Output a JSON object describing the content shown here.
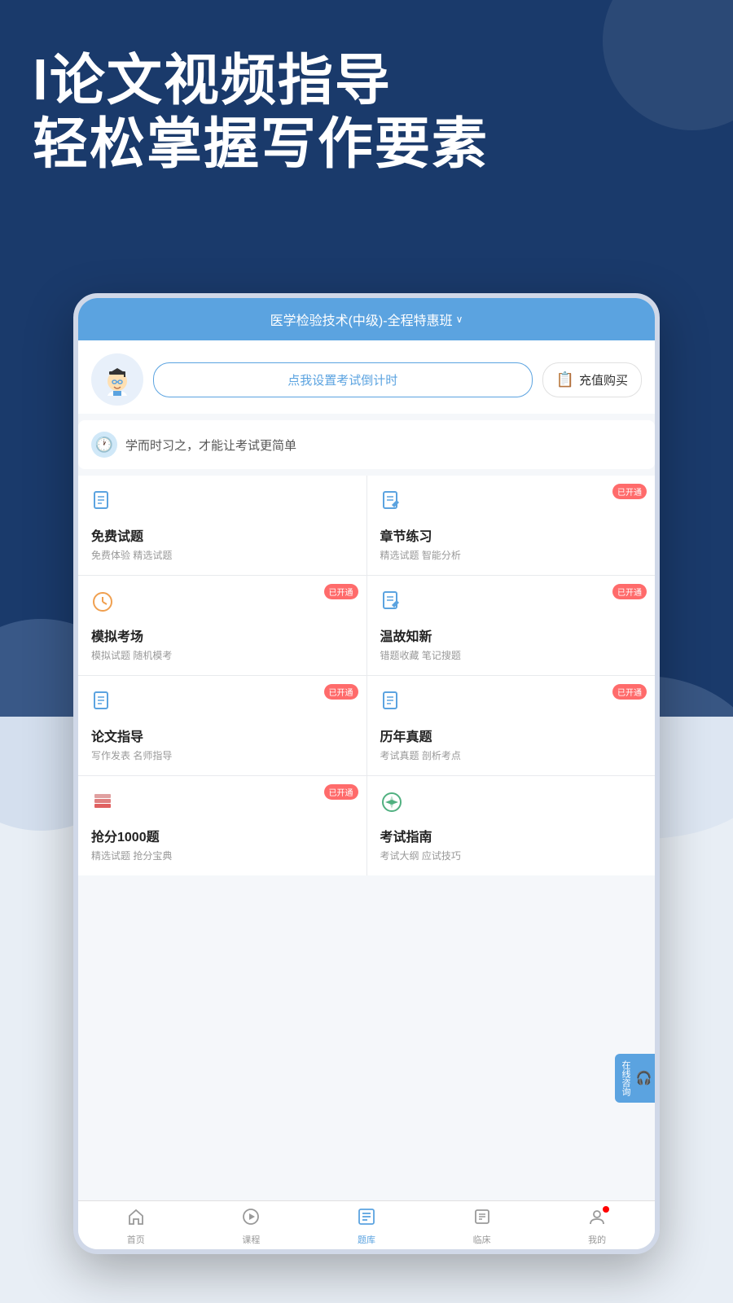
{
  "background": {
    "topColor": "#1a3a6b",
    "bottomColor": "#e8eef5"
  },
  "header": {
    "line1": "l论文视频指导",
    "line2": "轻松掌握写作要素"
  },
  "app": {
    "topBar": {
      "title": "医学检验技术(中级)-全程特惠班",
      "arrow": "∨"
    },
    "profile": {
      "countdown_btn": "点我设置考试倒计时",
      "recharge_btn": "充值购买"
    },
    "motto": "学而时习之，才能让考试更简单",
    "gridItems": [
      {
        "id": "free-questions",
        "icon": "📋",
        "title": "免费试题",
        "subtitle": "免费体验 精选试题",
        "badge": null,
        "iconType": "doc"
      },
      {
        "id": "chapter-practice",
        "icon": "📝",
        "title": "章节练习",
        "subtitle": "精选试题 智能分析",
        "badge": "已开通",
        "iconType": "pencil"
      },
      {
        "id": "mock-exam",
        "icon": "🕐",
        "title": "模拟考场",
        "subtitle": "模拟试题 随机模考",
        "badge": "已开通",
        "iconType": "clock"
      },
      {
        "id": "review",
        "icon": "✏️",
        "title": "温故知新",
        "subtitle": "错题收藏 笔记搜题",
        "badge": "已开通",
        "iconType": "pencil"
      },
      {
        "id": "essay-guide",
        "icon": "📄",
        "title": "论文指导",
        "subtitle": "写作发表 名师指导",
        "badge": "已开通",
        "iconType": "doc"
      },
      {
        "id": "past-exams",
        "icon": "📋",
        "title": "历年真题",
        "subtitle": "考试真题 剖析考点",
        "badge": "已开通",
        "iconType": "doc"
      },
      {
        "id": "grab-score",
        "icon": "📚",
        "title": "抢分1000题",
        "subtitle": "精选试题 抢分宝典",
        "badge": "已开通",
        "iconType": "stack"
      },
      {
        "id": "exam-guide",
        "icon": "🧭",
        "title": "考试指南",
        "subtitle": "考试大纲 应试技巧",
        "badge": null,
        "iconType": "compass"
      }
    ],
    "onlineConsult": {
      "icon": "🎧",
      "label": "在线咨询"
    },
    "bottomNav": [
      {
        "id": "home",
        "icon": "⌂",
        "label": "首页",
        "active": false
      },
      {
        "id": "course",
        "icon": "▷",
        "label": "课程",
        "active": false
      },
      {
        "id": "questions",
        "icon": "☰",
        "label": "题库",
        "active": true
      },
      {
        "id": "clinical",
        "icon": "📋",
        "label": "临床",
        "active": false
      },
      {
        "id": "mine",
        "icon": "◯",
        "label": "我的",
        "active": false,
        "dot": true
      }
    ]
  }
}
